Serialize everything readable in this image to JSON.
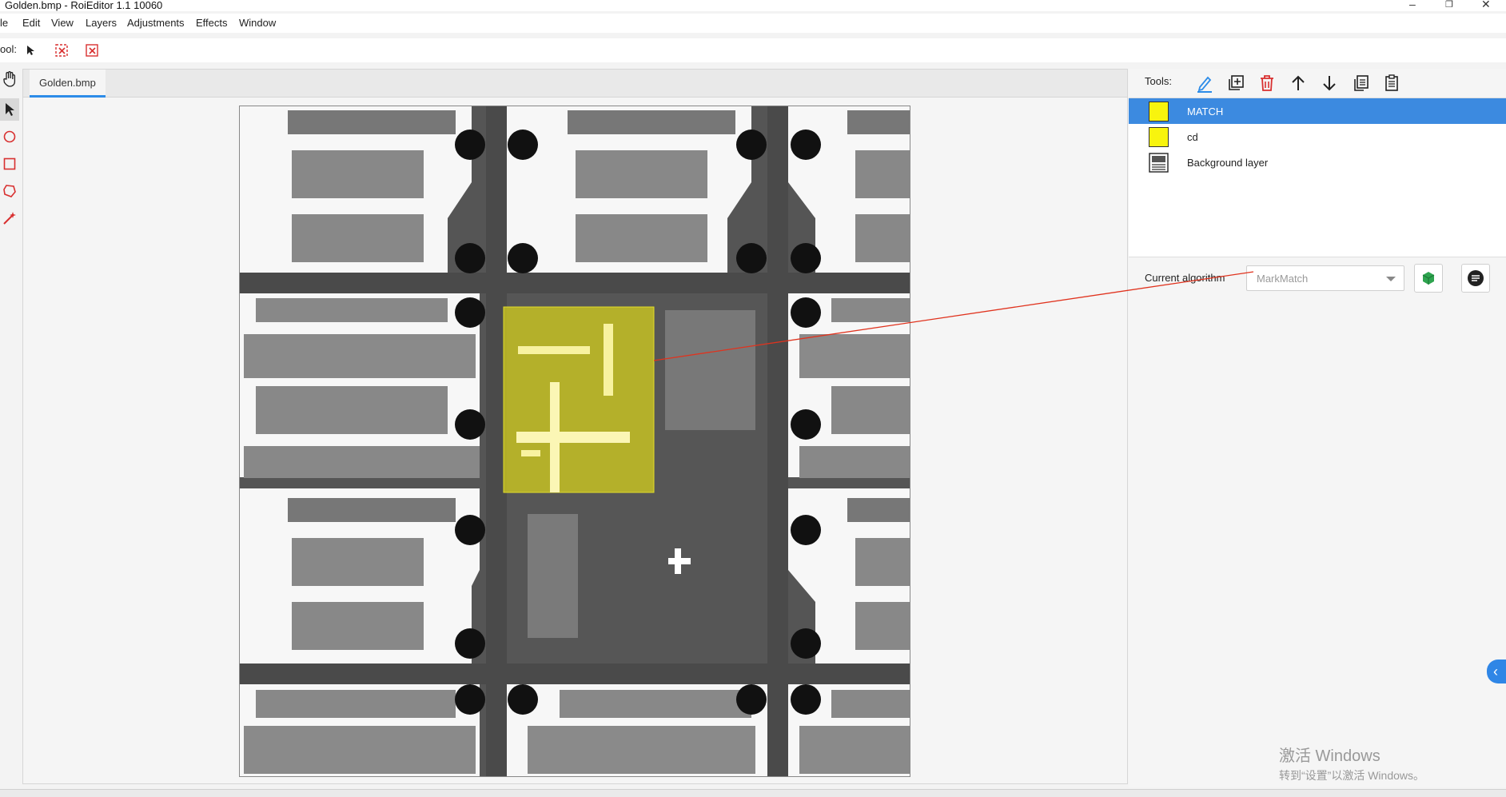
{
  "window": {
    "title": "Golden.bmp - RoiEditor 1.1 10060",
    "minimize": "–",
    "maximize": "❐",
    "close": "✕"
  },
  "menu": {
    "items": [
      "le",
      "Edit",
      "View",
      "Layers",
      "Adjustments",
      "Effects",
      "Window"
    ]
  },
  "toolbar": {
    "label": "ool:",
    "icons": [
      "pointer-icon",
      "clear-selection-icon",
      "clear-all-icon"
    ]
  },
  "left_tools": [
    "hand-icon",
    "select-arrow-icon",
    "ellipse-icon",
    "rectangle-icon",
    "polygon-icon",
    "magic-wand-icon"
  ],
  "document": {
    "tab_label": "Golden.bmp"
  },
  "right_panel": {
    "tools_label": "Tools:",
    "tool_icons": [
      "pen-icon",
      "add-layer-icon",
      "delete-icon",
      "move-up-icon",
      "move-down-icon",
      "copy-icon",
      "paste-icon"
    ],
    "layers": [
      {
        "name": "MATCH",
        "type": "roi",
        "color": "#f8f40e",
        "selected": true
      },
      {
        "name": "cd",
        "type": "roi",
        "color": "#f8f40e",
        "selected": false
      },
      {
        "name": "Background layer",
        "type": "background",
        "selected": false
      }
    ],
    "algorithm_label": "Current algorithm",
    "algorithm_value": "MarkMatch",
    "cube_button": "cube-icon",
    "settings_button": "list-settings-icon"
  },
  "watermark": {
    "line1": "激活 Windows",
    "line2": "转到“设置”以激活 Windows。"
  },
  "colors": {
    "accent": "#3c8ae0",
    "roi_fill": "#f8f40e",
    "link_line": "#e0331e",
    "danger_icon": "#d83030"
  }
}
